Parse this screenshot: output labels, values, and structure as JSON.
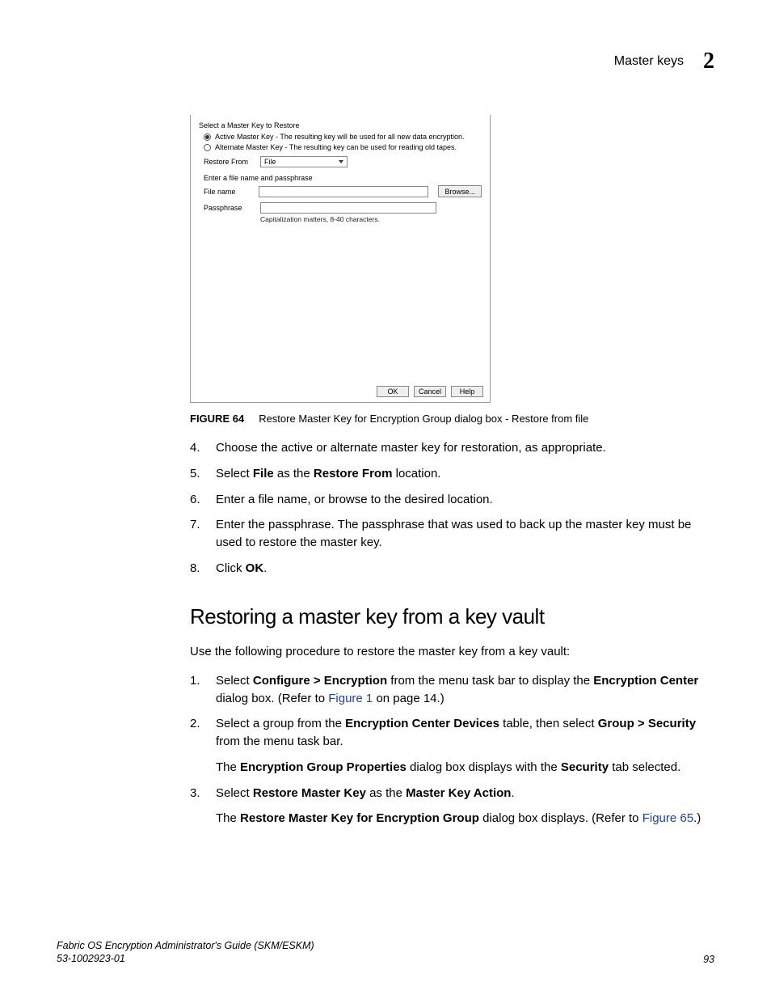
{
  "header": {
    "title": "Master keys",
    "chapter_number": "2"
  },
  "dialog": {
    "section_label": "Select a Master Key to Restore",
    "radio_active": "Active Master Key - The resulting key will be used for all new data encryption.",
    "radio_alternate": "Alternate Master Key - The resulting key can be used for reading old tapes.",
    "restore_from_label": "Restore From",
    "restore_from_value": "File",
    "subhead": "Enter a file name and passphrase",
    "file_name_label": "File name",
    "passphrase_label": "Passphrase",
    "hint": "Capitalization matters, 8-40 characters.",
    "browse_label": "Browse...",
    "ok_label": "OK",
    "cancel_label": "Cancel",
    "help_label": "Help"
  },
  "figure": {
    "label": "FIGURE 64",
    "caption": "Restore Master Key for Encryption Group dialog box - Restore from file"
  },
  "steps_a": [
    {
      "n": "4.",
      "pre": "Choose the active or alternate master key for restoration, as appropriate."
    },
    {
      "n": "5.",
      "pre": "Select ",
      "b1": "File",
      "mid": " as the ",
      "b2": "Restore From",
      "post": " location."
    },
    {
      "n": "6.",
      "pre": "Enter a file name, or browse to the desired location."
    },
    {
      "n": "7.",
      "pre": "Enter the passphrase. The passphrase that was used to back up the master key must be used to restore the master key."
    },
    {
      "n": "8.",
      "pre": "Click ",
      "b1": "OK",
      "post": "."
    }
  ],
  "section_heading": "Restoring a master key from a key vault",
  "intro": "Use the following procedure to restore the master key from a key vault:",
  "steps_b": {
    "s1": {
      "n": "1.",
      "t0": "Select ",
      "b0": "Configure > Encryption",
      "t1": " from the menu task bar to display the ",
      "b1": "Encryption Center",
      "t2": " dialog box. (Refer to ",
      "link": "Figure 1",
      "t3": " on page 14.)"
    },
    "s2": {
      "n": "2.",
      "t0": "Select a group from the ",
      "b0": "Encryption Center Devices",
      "t1": " table, then select ",
      "b1": "Group > Security",
      "t2": " from the menu task bar.",
      "sub_t0": "The ",
      "sub_b0": "Encryption Group Properties",
      "sub_t1": " dialog box displays with the ",
      "sub_b1": "Security",
      "sub_t2": " tab selected."
    },
    "s3": {
      "n": "3.",
      "t0": "Select ",
      "b0": "Restore Master Key",
      "t1": " as the ",
      "b1": "Master Key Action",
      "t2": ".",
      "sub_t0": "The ",
      "sub_b0": "Restore Master Key for Encryption Group",
      "sub_t1": " dialog box displays. (Refer to ",
      "sub_link": "Figure 65",
      "sub_t2": ".)"
    }
  },
  "footer": {
    "line1": "Fabric OS Encryption Administrator's Guide (SKM/ESKM)",
    "line2": "53-1002923-01",
    "page": "93"
  }
}
